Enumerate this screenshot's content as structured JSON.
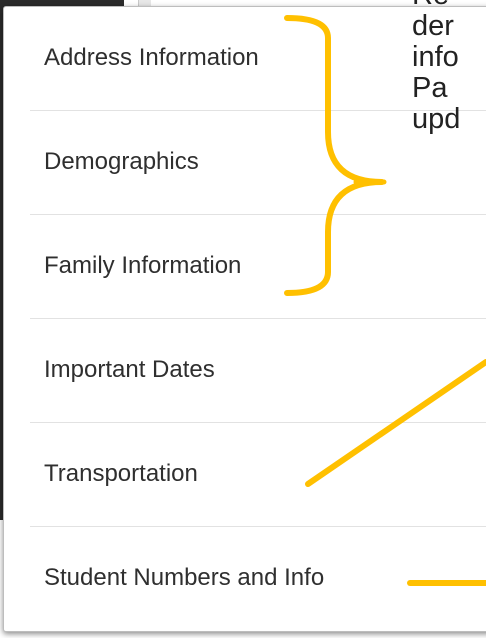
{
  "menu": {
    "items": [
      {
        "label": "Address Information"
      },
      {
        "label": "Demographics"
      },
      {
        "label": "Family Information"
      },
      {
        "label": "Important Dates"
      },
      {
        "label": "Transportation"
      },
      {
        "label": "Student Numbers and Info"
      }
    ]
  },
  "callout": {
    "lines": [
      "Re",
      "der",
      "info",
      "Pa",
      "upd"
    ]
  },
  "colors": {
    "annotation": "#FFC000",
    "menu_text": "#2F2F2F",
    "frame_dark": "#2B2B2B"
  }
}
